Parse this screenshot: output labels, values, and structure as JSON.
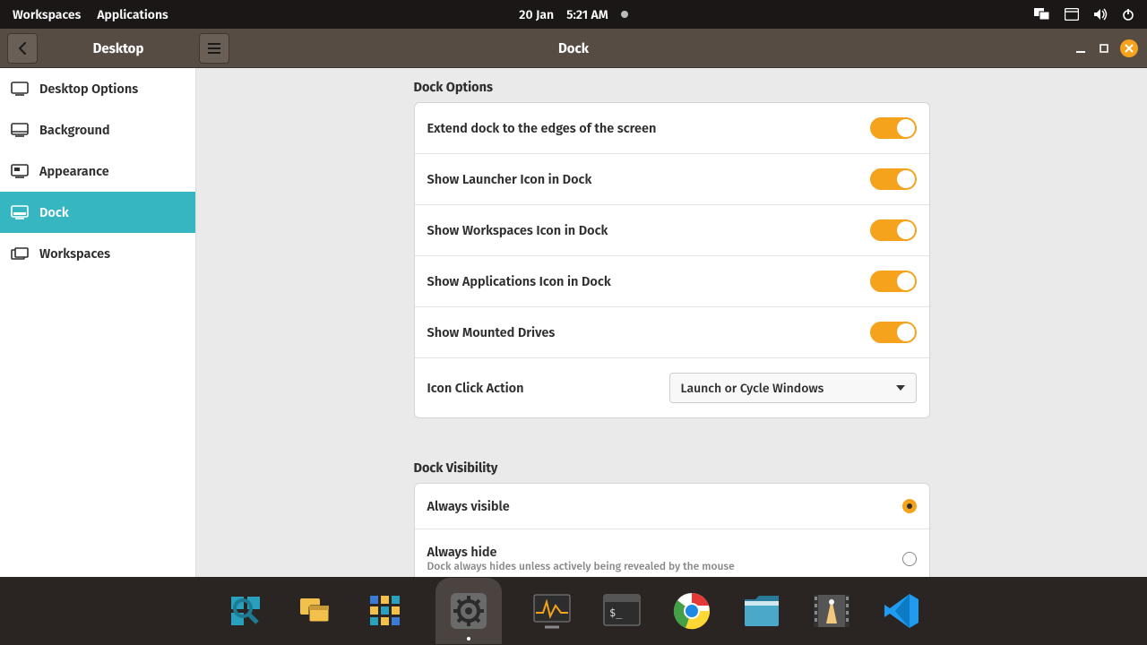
{
  "topbar": {
    "workspaces": "Workspaces",
    "applications": "Applications",
    "date": "20 Jan",
    "time": "5:21 AM"
  },
  "window": {
    "back_label": "Desktop",
    "title": "Dock"
  },
  "sidebar": {
    "items": [
      {
        "label": "Desktop Options"
      },
      {
        "label": "Background"
      },
      {
        "label": "Appearance"
      },
      {
        "label": "Dock"
      },
      {
        "label": "Workspaces"
      }
    ]
  },
  "sections": {
    "dock_options": {
      "title": "Dock Options",
      "rows": [
        {
          "label": "Extend dock to the edges of the screen"
        },
        {
          "label": "Show Launcher Icon in Dock"
        },
        {
          "label": "Show Workspaces Icon in Dock"
        },
        {
          "label": "Show Applications Icon in Dock"
        },
        {
          "label": "Show Mounted Drives"
        }
      ],
      "click_action": {
        "label": "Icon Click Action",
        "value": "Launch or Cycle Windows"
      }
    },
    "dock_visibility": {
      "title": "Dock Visibility",
      "rows": [
        {
          "label": "Always visible"
        },
        {
          "label": "Always hide",
          "sub": "Dock always hides unless actively being revealed by the mouse"
        }
      ]
    }
  },
  "colors": {
    "accent": "#f5a21c",
    "sidebar_active": "#36b6c0"
  }
}
